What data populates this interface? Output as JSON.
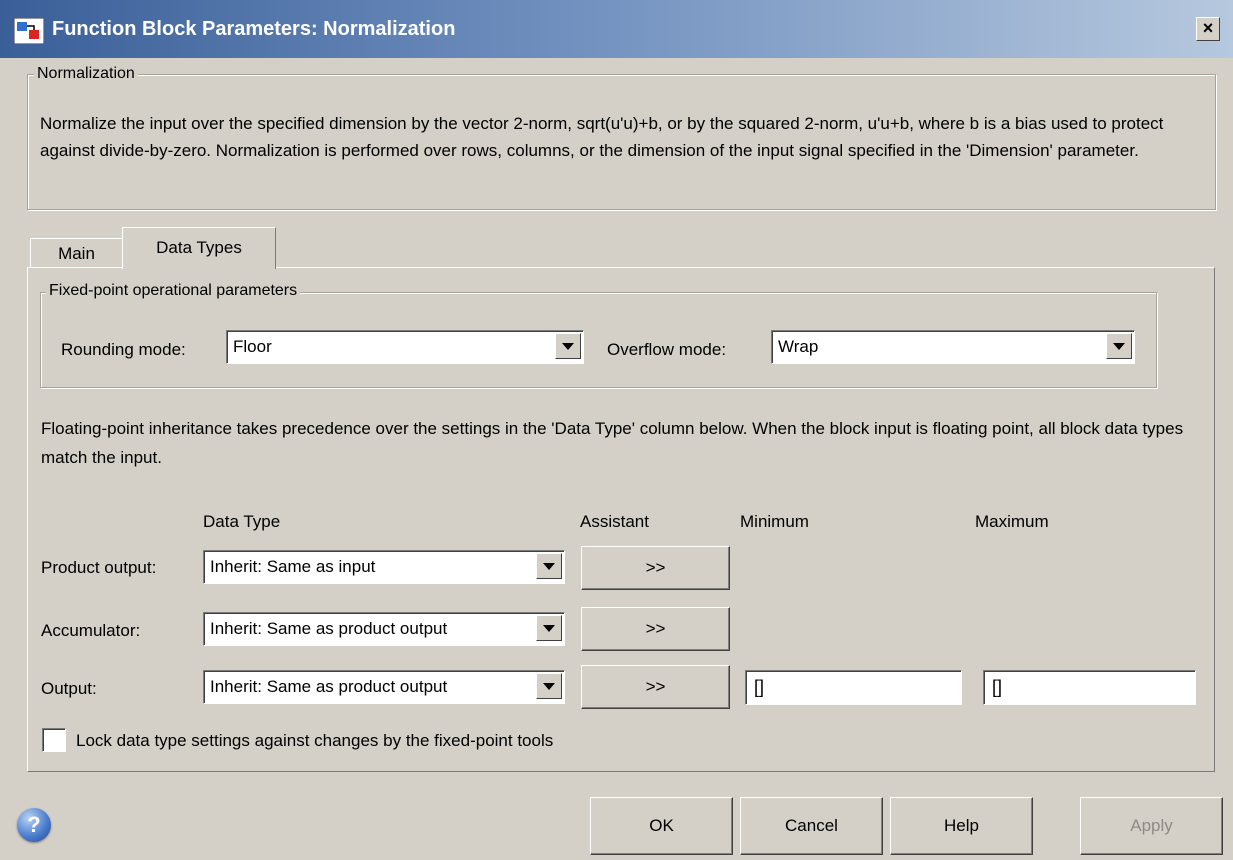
{
  "window": {
    "title": "Function Block Parameters: Normalization",
    "close_label": "×"
  },
  "description": {
    "legend": "Normalization",
    "text": "Normalize the input over the specified dimension by the vector 2-norm, sqrt(u'u)+b, or by the squared 2-norm, u'u+b, where b is a bias used to protect against divide-by-zero.  Normalization is performed over rows, columns, or the dimension of the input signal specified in the 'Dimension' parameter."
  },
  "tabs": [
    {
      "label": "Main",
      "selected": false
    },
    {
      "label": "Data Types",
      "selected": true
    }
  ],
  "fixed_point": {
    "legend": "Fixed-point operational parameters",
    "rounding_label": "Rounding mode:",
    "rounding_value": "Floor",
    "overflow_label": "Overflow mode:",
    "overflow_value": "Wrap"
  },
  "info_text": "Floating-point inheritance takes precedence over the settings in the 'Data Type' column below. When the block input is floating point, all block data types match the input.",
  "table": {
    "headers": {
      "data_type": "Data Type",
      "assistant": "Assistant",
      "minimum": "Minimum",
      "maximum": "Maximum"
    },
    "rows": [
      {
        "label": "Product output:",
        "data_type": "Inherit: Same as input",
        "assistant": ">>"
      },
      {
        "label": "Accumulator:",
        "data_type": "Inherit: Same as product output",
        "assistant": ">>"
      },
      {
        "label": "Output:",
        "data_type": "Inherit: Same as product output",
        "assistant": ">>",
        "minimum": "[]",
        "maximum": "[]"
      }
    ]
  },
  "lock": {
    "label": "Lock data type settings against changes by the fixed-point tools",
    "checked": false
  },
  "footer": {
    "help_icon": "?",
    "ok": "OK",
    "cancel": "Cancel",
    "help": "Help",
    "apply": "Apply",
    "apply_enabled": false
  }
}
